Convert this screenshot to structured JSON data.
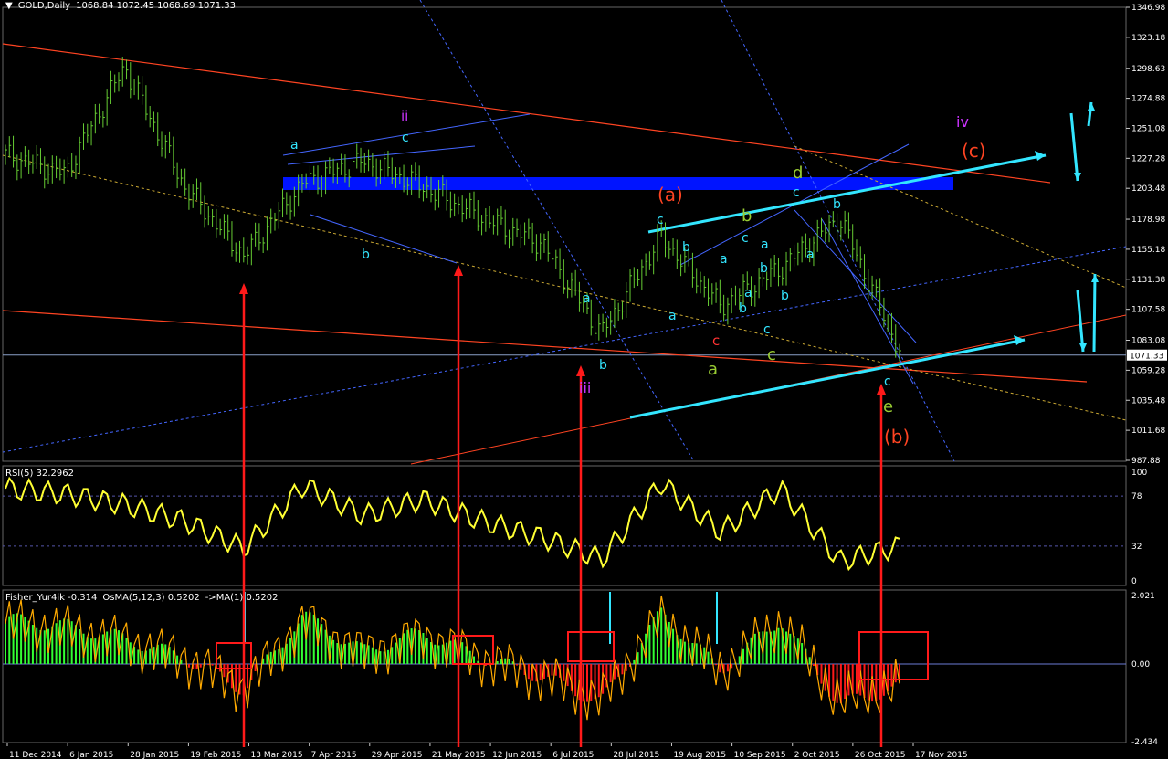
{
  "header": {
    "symbol": "GOLD,Daily",
    "ohlc": "1068.84 1072.45 1068.69 1071.33",
    "rsi": "RSI(5) 32.2962",
    "fisher": "Fisher_Yur4ik -0.314",
    "osma": "OsMA(5,12,3) 0.5202",
    "ma": "->MA(1) 0.5202"
  },
  "colors": {
    "price": "#66cc33",
    "rsi": "#ffff33",
    "fisher": "#ffaa00",
    "histUp": "#33ff33",
    "histDown": "#ff1a1a",
    "trend": "#ff4422",
    "cyan": "#33e6ff",
    "zone": "#0014ff"
  },
  "chart_data": {
    "type": "line",
    "price_axis": [
      "1346.98",
      "1323.18",
      "1298.63",
      "1274.88",
      "1251.08",
      "1227.28",
      "1203.48",
      "1178.98",
      "1155.18",
      "1131.38",
      "1107.58",
      "1083.08",
      "1059.28",
      "1035.48",
      "1011.68",
      "987.88"
    ],
    "current_price": "1071.33",
    "rsi_axis": [
      "100",
      "78",
      "32",
      "0"
    ],
    "osc_axis": [
      "2.021",
      "0.00",
      "-2.434"
    ],
    "dates": [
      "11 Dec 2014",
      "6 Jan 2015",
      "28 Jan 2015",
      "19 Feb 2015",
      "13 Mar 2015",
      "7 Apr 2015",
      "29 Apr 2015",
      "21 May 2015",
      "12 Jun 2015",
      "6 Jul 2015",
      "28 Jul 2015",
      "19 Aug 2015",
      "10 Sep 2015",
      "2 Oct 2015",
      "26 Oct 2015",
      "17 Nov 2015"
    ],
    "price_series": {
      "name": "GOLD,Daily",
      "dates": [
        "11 Dec 2014",
        "6 Jan 2015",
        "28 Jan 2015",
        "19 Feb 2015",
        "13 Mar 2015",
        "7 Apr 2015",
        "29 Apr 2015",
        "21 May 2015",
        "12 Jun 2015",
        "6 Jul 2015",
        "28 Jul 2015",
        "19 Aug 2015",
        "10 Sep 2015",
        "2 Oct 2015",
        "26 Oct 2015",
        "17 Nov 2015"
      ],
      "close": [
        1230,
        1215,
        1300,
        1205,
        1150,
        1208,
        1225,
        1205,
        1180,
        1160,
        1088,
        1165,
        1110,
        1140,
        1180,
        1075
      ]
    },
    "rsi_series": [
      85,
      80,
      70,
      55,
      30,
      88,
      60,
      75,
      55,
      40,
      20,
      90,
      45,
      85,
      18,
      32
    ],
    "wave_labels": [
      {
        "text": "a",
        "color": "#33e6ff"
      },
      {
        "text": "b",
        "color": "#33e6ff"
      },
      {
        "text": "c",
        "color": "#33e6ff"
      },
      {
        "text": "ii",
        "color": "#cc33ff"
      },
      {
        "text": "iii",
        "color": "#cc33ff"
      },
      {
        "text": "iv",
        "color": "#cc33ff"
      },
      {
        "text": "(a)",
        "color": "#ff4422"
      },
      {
        "text": "(b)",
        "color": "#ff4422"
      },
      {
        "text": "(c)",
        "color": "#ff4422"
      },
      {
        "text": "a",
        "color": "#99cc33"
      },
      {
        "text": "b",
        "color": "#99cc33"
      },
      {
        "text": "c",
        "color": "#99cc33"
      },
      {
        "text": "d",
        "color": "#99cc33"
      },
      {
        "text": "e",
        "color": "#99cc33"
      },
      {
        "text": "c",
        "color": "#ff3333"
      }
    ]
  }
}
